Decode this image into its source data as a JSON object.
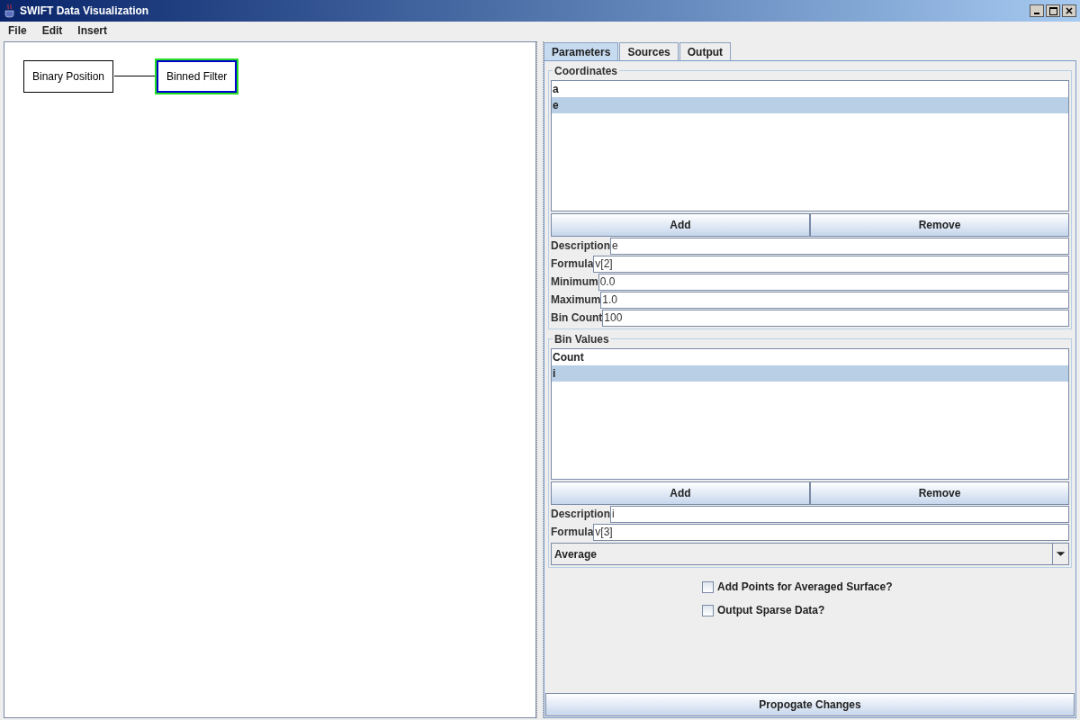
{
  "window": {
    "title": "SWIFT Data Visualization"
  },
  "menu": [
    "File",
    "Edit",
    "Insert"
  ],
  "canvas": {
    "nodes": [
      {
        "label": "Binary Position",
        "selected": false
      },
      {
        "label": "Binned Filter",
        "selected": true
      }
    ]
  },
  "tabs": [
    {
      "label": "Parameters",
      "selected": true
    },
    {
      "label": "Sources",
      "selected": false
    },
    {
      "label": "Output",
      "selected": false
    }
  ],
  "coordinates": {
    "title": "Coordinates",
    "items": [
      {
        "label": "a",
        "selected": false
      },
      {
        "label": "e",
        "selected": true
      }
    ],
    "buttons": [
      "Add",
      "Remove"
    ],
    "fields": [
      {
        "label": "Description",
        "value": "e"
      },
      {
        "label": "Formula",
        "value": "v[2]"
      },
      {
        "label": "Minimum",
        "value": "0.0"
      },
      {
        "label": "Maximum",
        "value": "1.0"
      },
      {
        "label": "Bin Count",
        "value": "100"
      }
    ]
  },
  "bin_values": {
    "title": "Bin Values",
    "items": [
      {
        "label": "Count",
        "selected": false
      },
      {
        "label": "i",
        "selected": true
      }
    ],
    "buttons": [
      "Add",
      "Remove"
    ],
    "fields": [
      {
        "label": "Description",
        "value": "i"
      },
      {
        "label": "Formula",
        "value": "v[3]"
      }
    ],
    "dropdown": {
      "value": "Average"
    }
  },
  "checkboxes": [
    {
      "label": "Add Points for Averaged Surface?",
      "checked": false
    },
    {
      "label": "Output Sparse Data?",
      "checked": false
    }
  ],
  "propagate_button": "Propogate Changes"
}
